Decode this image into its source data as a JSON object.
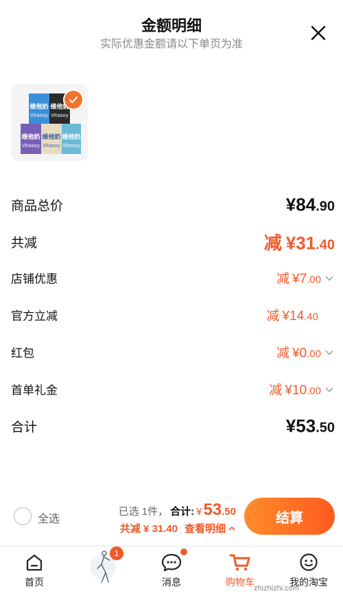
{
  "header": {
    "title": "金额明细",
    "subtitle": "实际优惠金额请以下单页为准",
    "close_icon": "close-icon"
  },
  "product": {
    "brand_text": "维他奶",
    "brand_latin": "Vitasoy",
    "selected": true
  },
  "rows": {
    "goods_total": {
      "label": "商品总价",
      "yen": "¥",
      "int": "84",
      "dec": ".90"
    },
    "total_discount": {
      "label": "共减",
      "prefix": "减",
      "yen": "¥",
      "int": "31",
      "dec": ".40"
    },
    "shop_discount": {
      "label": "店铺优惠",
      "prefix": "减",
      "yen": "¥",
      "int": "7",
      "dec": ".00"
    },
    "official_discount": {
      "label": "官方立减",
      "prefix": "减",
      "yen": "¥",
      "int": "14",
      "dec": ".40"
    },
    "red_packet": {
      "label": "红包",
      "prefix": "减",
      "yen": "¥",
      "int": "0",
      "dec": ".00"
    },
    "first_order_gift": {
      "label": "首单礼金",
      "prefix": "减",
      "yen": "¥",
      "int": "10",
      "dec": ".00"
    },
    "sum": {
      "label": "合计",
      "yen": "¥",
      "int": "53",
      "dec": ".50"
    }
  },
  "bottom": {
    "select_all": "全选",
    "selected_text": "已选 1件，",
    "total_label": "合计:",
    "yen": "¥",
    "total_int": "53",
    "total_dec": ".50",
    "discount_text": "共减 ¥ 31.40",
    "detail_text": "查看明细",
    "checkout": "结算"
  },
  "tabs": [
    {
      "label": "首页",
      "icon": "home-icon"
    },
    {
      "label": "",
      "icon": "avatar-figure-icon",
      "badge": "1"
    },
    {
      "label": "消息",
      "icon": "message-icon"
    },
    {
      "label": "购物车",
      "icon": "cart-icon"
    },
    {
      "label": "我的淘宝",
      "icon": "profile-icon"
    }
  ],
  "watermark": "zhizhizhi.com",
  "colors": {
    "accent": "#f05a2a",
    "checkout_start": "#ff8c2a",
    "checkout_end": "#ff5a1f"
  }
}
